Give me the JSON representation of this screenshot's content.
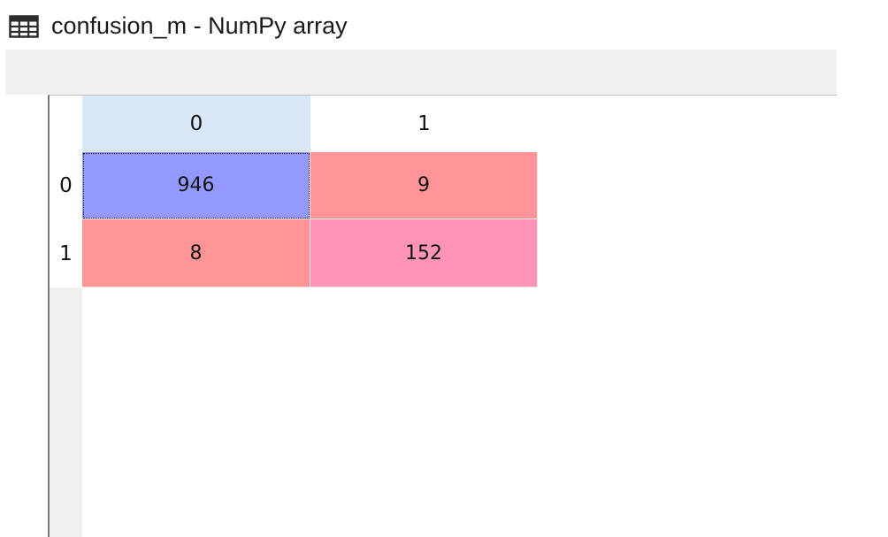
{
  "window": {
    "title": "confusion_m - NumPy array",
    "icon": "table-grid-icon"
  },
  "table": {
    "column_headers": [
      "0",
      "1"
    ],
    "row_headers": [
      "0",
      "1"
    ],
    "cells": [
      [
        "946",
        "9"
      ],
      [
        "8",
        "152"
      ]
    ],
    "selected_cell": [
      0,
      0
    ]
  },
  "colors": {
    "selected_column_header": "#d9e8f6",
    "cell_946": "#9499ff",
    "cell_9": "#ff9498",
    "cell_8": "#ff9496",
    "cell_152": "#ff94b8",
    "toolbar": "#f0f0f0"
  }
}
